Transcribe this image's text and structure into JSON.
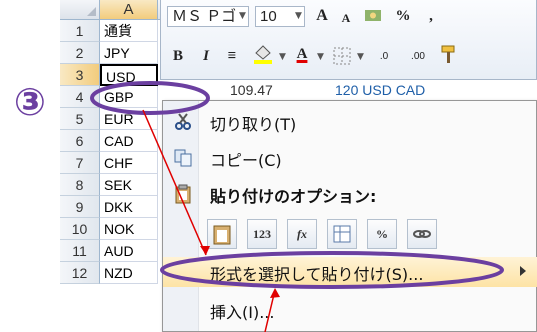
{
  "sheet": {
    "column_header": "A",
    "rows": [
      {
        "num": "1",
        "value": "通貨"
      },
      {
        "num": "2",
        "value": "JPY"
      },
      {
        "num": "3",
        "value": "USD"
      },
      {
        "num": "4",
        "value": "GBP"
      },
      {
        "num": "5",
        "value": "EUR"
      },
      {
        "num": "6",
        "value": "CAD"
      },
      {
        "num": "7",
        "value": "CHF"
      },
      {
        "num": "8",
        "value": "SEK"
      },
      {
        "num": "9",
        "value": "DKK"
      },
      {
        "num": "10",
        "value": "NOK"
      },
      {
        "num": "11",
        "value": "AUD"
      },
      {
        "num": "12",
        "value": "NZD"
      }
    ],
    "partial_cells": [
      "109.47",
      "120 USD CAD"
    ]
  },
  "mini_toolbar": {
    "font_name": "ＭＳ Ｐゴ",
    "font_size": "10",
    "grow_font": "A",
    "shrink_font": "A",
    "percent": "%",
    "comma": ",",
    "bold": "B",
    "italic": "I",
    "align": "≡",
    "font_color": "A",
    "inc_decimal": ".0",
    "dec_decimal": ".00"
  },
  "context_menu": {
    "cut": "切り取り(T)",
    "copy": "コピー(C)",
    "paste_options_heading": "貼り付けのオプション:",
    "paste_buttons": [
      "",
      "123",
      "fx",
      "",
      "%",
      ""
    ],
    "paste_special": "形式を選択して貼り付け(S)...",
    "insert": "挿入(I)..."
  },
  "annotation": {
    "step_number": "③",
    "color": "#6b3fa0",
    "arrow_color": "#e00000"
  }
}
